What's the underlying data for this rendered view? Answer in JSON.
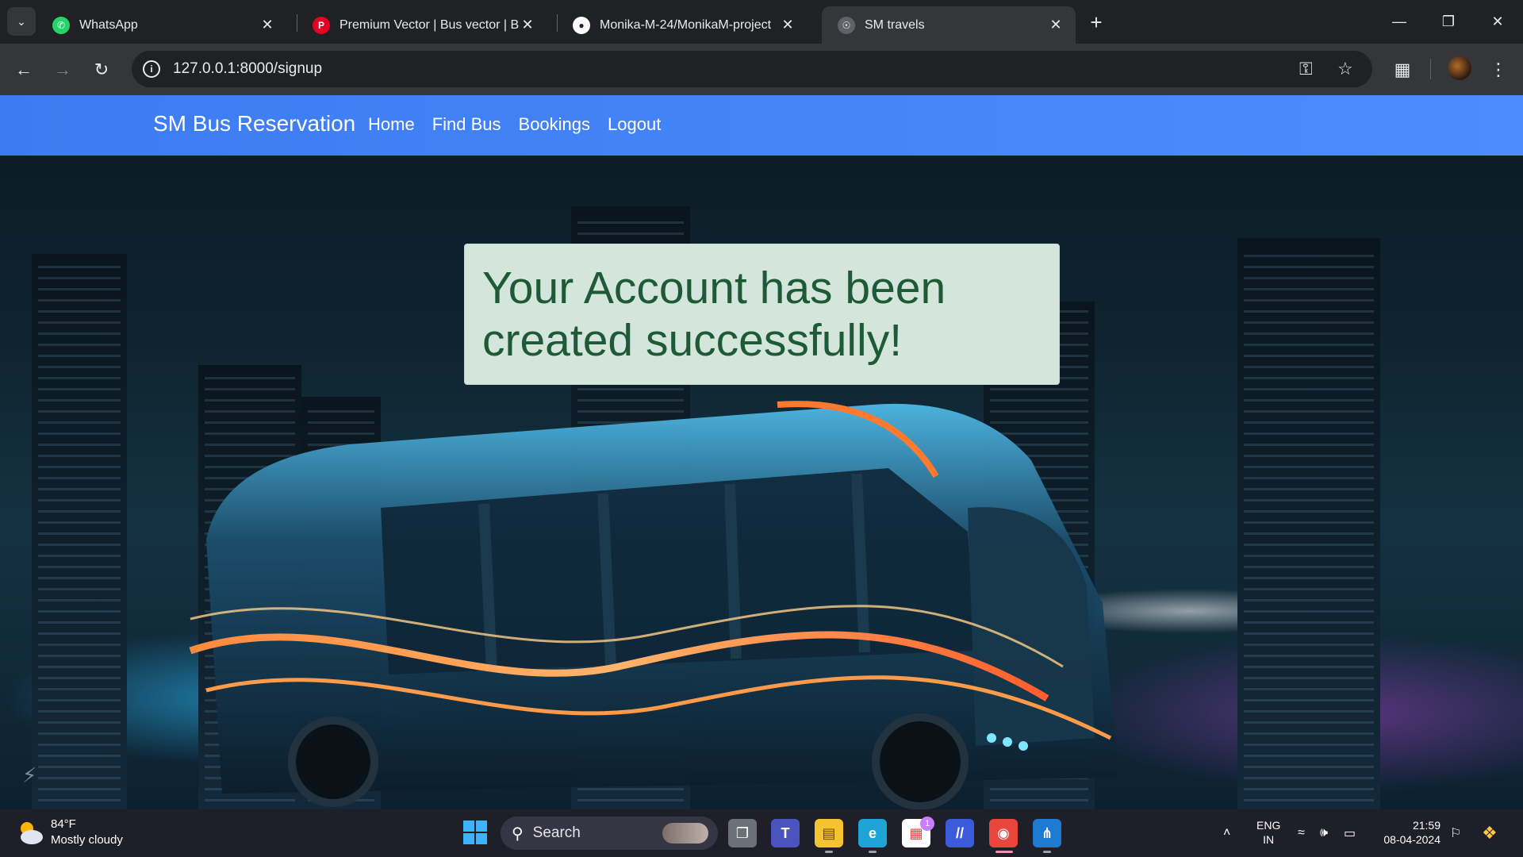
{
  "tabs": [
    {
      "title": "WhatsApp",
      "icon": "whatsapp-icon",
      "color": "#25d366"
    },
    {
      "title": "Premium Vector | Bus vector | Bus",
      "icon": "pinterest-icon",
      "color": "#e60023"
    },
    {
      "title": "Monika-M-24/MonikaM-project",
      "icon": "github-icon",
      "color": "#ffffff"
    },
    {
      "title": "SM travels",
      "icon": "globe-icon",
      "color": "#9aa0a6"
    }
  ],
  "address_bar": {
    "url": "127.0.0.1:8000/signup"
  },
  "navbar": {
    "brand": "SM Bus Reservation",
    "links": [
      "Home",
      "Find Bus",
      "Bookings",
      "Logout"
    ],
    "color": "#4285f4"
  },
  "alert": {
    "message": "Your Account has been created successfully!",
    "color": "#1e5a36"
  },
  "taskbar": {
    "weather_temp": "84°F",
    "weather_condition": "Mostly cloudy",
    "search_label": "Search",
    "store_badge": "1",
    "language": "ENG",
    "region": "IN",
    "time": "21:59",
    "date": "08-04-2024"
  }
}
